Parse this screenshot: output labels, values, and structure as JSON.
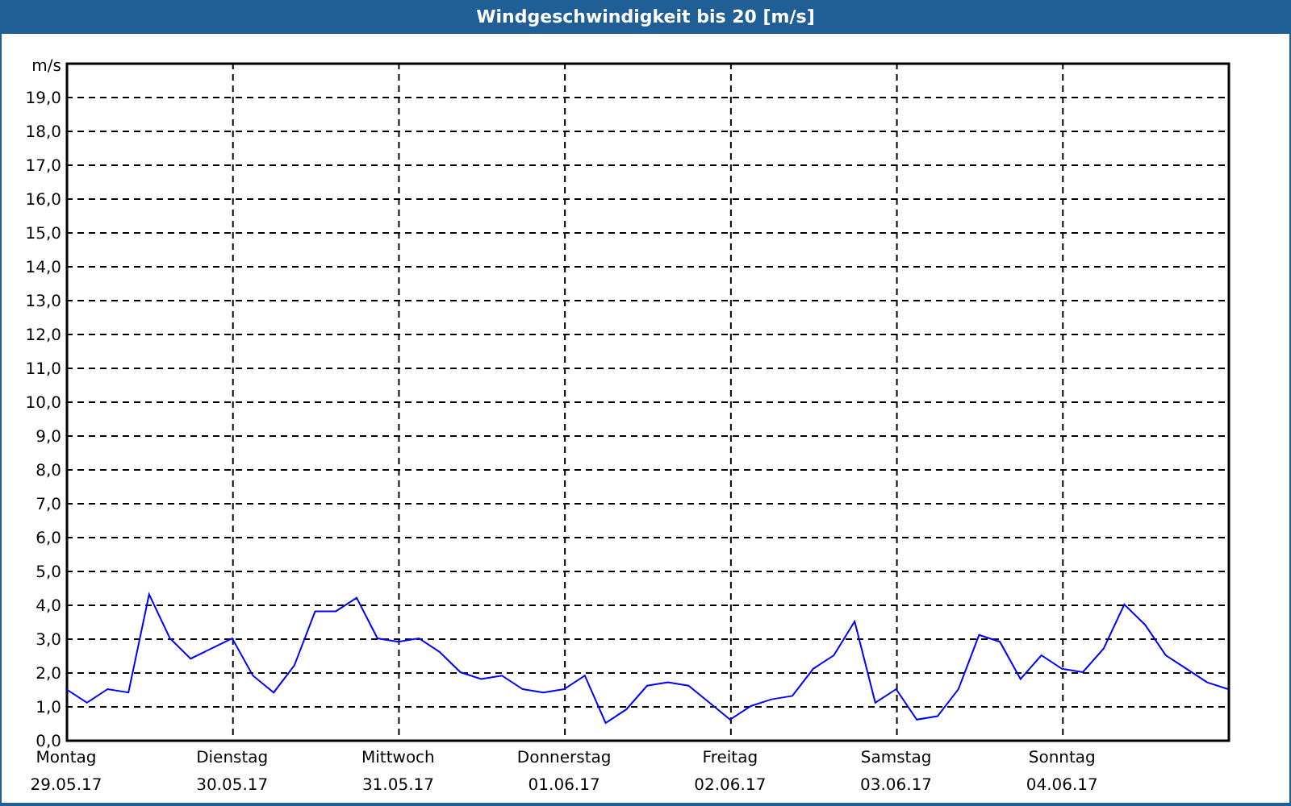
{
  "window": {
    "title": "Windgeschwindigkeit bis 20 [m/s]"
  },
  "chart_data": {
    "type": "line",
    "grid": true,
    "ylabel": "m/s",
    "ylim": [
      0,
      20
    ],
    "yticks": [
      {
        "value": 0,
        "label": "0,0"
      },
      {
        "value": 1,
        "label": "1,0"
      },
      {
        "value": 2,
        "label": "2,0"
      },
      {
        "value": 3,
        "label": "3,0"
      },
      {
        "value": 4,
        "label": "4,0"
      },
      {
        "value": 5,
        "label": "5,0"
      },
      {
        "value": 6,
        "label": "6,0"
      },
      {
        "value": 7,
        "label": "7,0"
      },
      {
        "value": 8,
        "label": "8,0"
      },
      {
        "value": 9,
        "label": "9,0"
      },
      {
        "value": 10,
        "label": "10,0"
      },
      {
        "value": 11,
        "label": "11,0"
      },
      {
        "value": 12,
        "label": "12,0"
      },
      {
        "value": 13,
        "label": "13,0"
      },
      {
        "value": 14,
        "label": "14,0"
      },
      {
        "value": 15,
        "label": "15,0"
      },
      {
        "value": 16,
        "label": "16,0"
      },
      {
        "value": 17,
        "label": "17,0"
      },
      {
        "value": 18,
        "label": "18,0"
      },
      {
        "value": 19,
        "label": "19,0"
      }
    ],
    "categories": [
      "Montag\n29.05.17",
      null,
      null,
      null,
      null,
      null,
      null,
      null,
      "Dienstag\n30.05.17",
      null,
      null,
      null,
      null,
      null,
      null,
      null,
      "Mittwoch\n31.05.17",
      null,
      null,
      null,
      null,
      null,
      null,
      null,
      "Donnerstag\n01.06.17",
      null,
      null,
      null,
      null,
      null,
      null,
      null,
      "Freitag\n02.06.17",
      null,
      null,
      null,
      null,
      null,
      null,
      null,
      "Samstag\n03.06.17",
      null,
      null,
      null,
      null,
      null,
      null,
      null,
      "Sonntag\n04.06.17",
      null,
      null,
      null,
      null,
      null,
      null,
      null,
      null
    ],
    "series": [
      {
        "color": "#0000ff",
        "values": [
          1.5,
          1.1,
          1.5,
          1.4,
          4.3,
          3.0,
          2.4,
          2.7,
          3.0,
          1.9,
          1.4,
          2.2,
          3.8,
          3.8,
          4.2,
          3.0,
          2.9,
          3.0,
          2.6,
          2.0,
          1.8,
          1.9,
          1.5,
          1.4,
          1.5,
          1.9,
          0.5,
          0.9,
          1.6,
          1.7,
          1.6,
          1.1,
          0.6,
          1.0,
          1.2,
          1.3,
          2.1,
          2.5,
          3.5,
          1.1,
          1.5,
          0.6,
          0.7,
          1.5,
          3.1,
          2.9,
          1.8,
          2.5,
          2.1,
          2.0,
          2.7,
          4.0,
          3.4,
          2.5,
          2.1,
          1.7,
          1.5
        ]
      }
    ]
  }
}
